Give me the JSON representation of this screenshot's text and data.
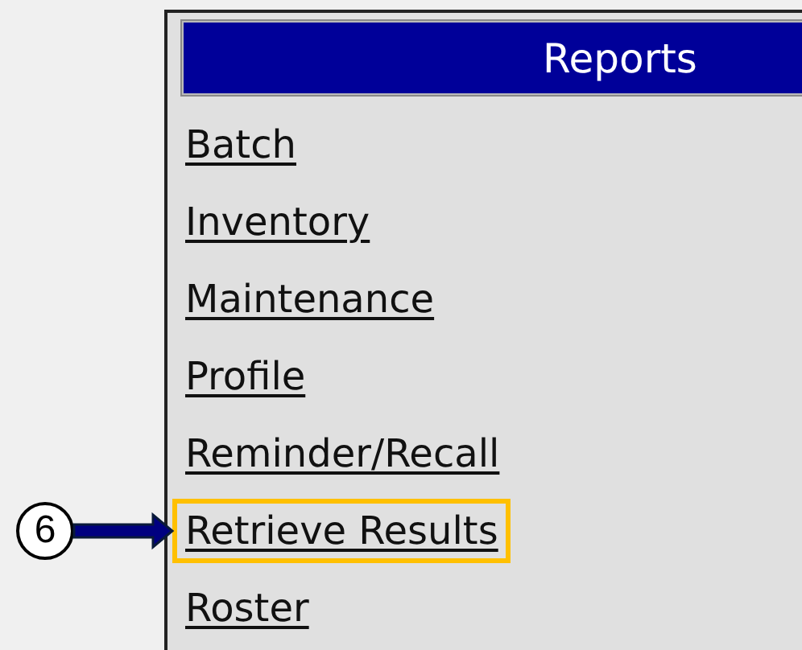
{
  "menu": {
    "title": "Reports",
    "items": [
      {
        "label": "Batch",
        "highlighted": false
      },
      {
        "label": "Inventory",
        "highlighted": false
      },
      {
        "label": "Maintenance",
        "highlighted": false
      },
      {
        "label": "Profile",
        "highlighted": false
      },
      {
        "label": "Reminder/Recall",
        "highlighted": false
      },
      {
        "label": "Retrieve Results",
        "highlighted": true
      },
      {
        "label": "Roster",
        "highlighted": false
      }
    ]
  },
  "callout": {
    "number": "6"
  }
}
